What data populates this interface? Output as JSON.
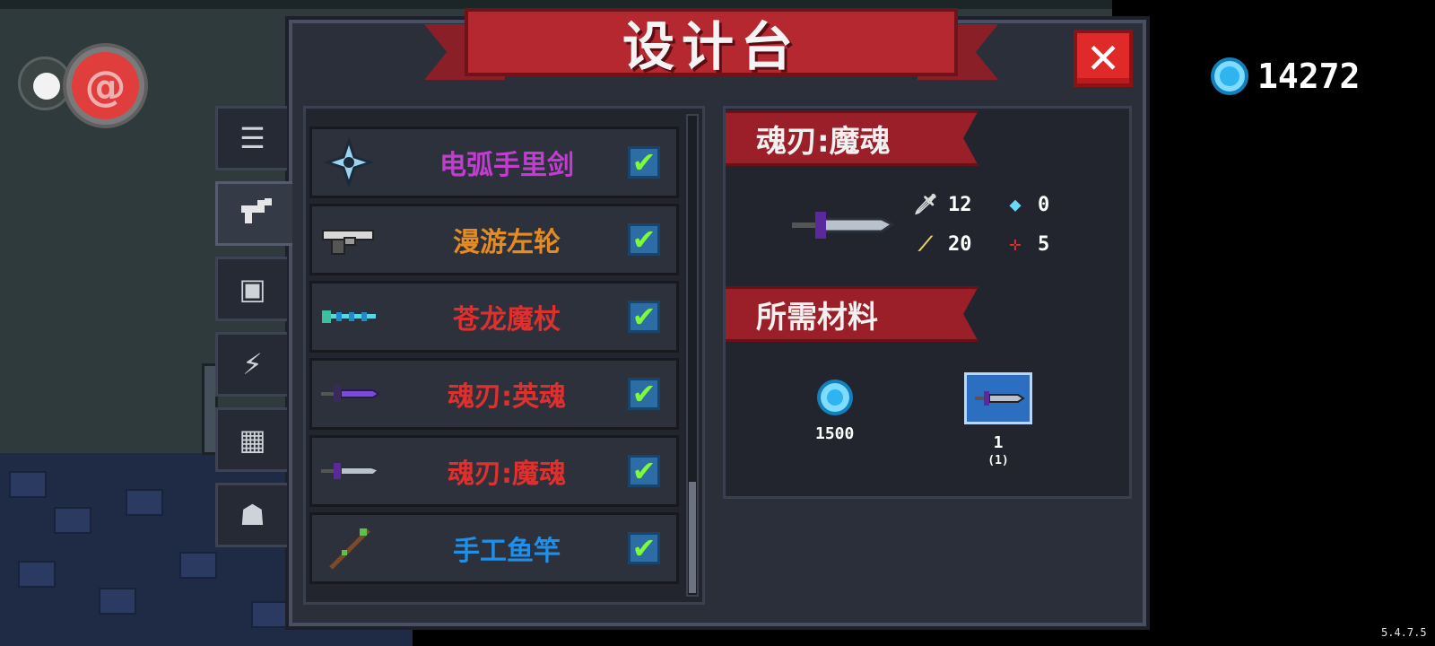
{
  "title": "设计台",
  "currency": {
    "icon": "gem-icon",
    "amount": "14272",
    "color": "#2fb4f0"
  },
  "close_icon": "close-icon",
  "tabs": [
    {
      "icon": "list-icon",
      "glyph": "☰",
      "active": false
    },
    {
      "icon": "weapon-icon",
      "glyph": "🔫",
      "active": true
    },
    {
      "icon": "armor-icon",
      "glyph": "▣",
      "active": false
    },
    {
      "icon": "lightning-icon",
      "glyph": "⚡",
      "active": false
    },
    {
      "icon": "material-icon",
      "glyph": "▦",
      "active": false
    },
    {
      "icon": "character-icon",
      "glyph": "☗",
      "active": false
    }
  ],
  "list": {
    "items": [
      {
        "name": "电弧手里剑",
        "color": "#c23cd0",
        "icon": "shuriken-icon",
        "checked": true
      },
      {
        "name": "漫游左轮",
        "color": "#e58b1f",
        "icon": "revolver-icon",
        "checked": true
      },
      {
        "name": "苍龙魔杖",
        "color": "#e0302e",
        "icon": "staff-icon",
        "checked": true
      },
      {
        "name": "魂刃:英魂",
        "color": "#e0302e",
        "icon": "purple-blade-icon",
        "checked": true
      },
      {
        "name": "魂刃:魔魂",
        "color": "#e0302e",
        "icon": "dark-blade-icon",
        "checked": true
      },
      {
        "name": "手工鱼竿",
        "color": "#1f8fe8",
        "icon": "fishing-rod-icon",
        "checked": true
      }
    ],
    "scroll_position": 0.76
  },
  "detail": {
    "weapon_name": "魂刃:魔魂",
    "stats": [
      {
        "icon": "damage-icon",
        "value": "12"
      },
      {
        "icon": "energy-icon",
        "value": "0"
      },
      {
        "icon": "crit-icon",
        "value": "20"
      },
      {
        "icon": "accuracy-icon",
        "value": "5"
      }
    ],
    "materials_title": "所需材料",
    "materials": [
      {
        "icon": "gem-icon",
        "value": "1500",
        "sub": ""
      },
      {
        "icon": "blueprint-icon",
        "value": "1",
        "sub": "(1)"
      }
    ]
  },
  "version": "5.4.7.5"
}
